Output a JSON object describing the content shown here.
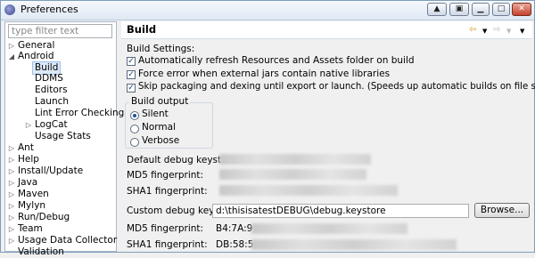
{
  "window": {
    "title": "Preferences"
  },
  "filter": {
    "placeholder": "type filter text"
  },
  "tree": {
    "general": "General",
    "android": "Android",
    "build": "Build",
    "ddms": "DDMS",
    "editors": "Editors",
    "launch": "Launch",
    "lint": "Lint Error Checking",
    "logcat": "LogCat",
    "usage_stats": "Usage Stats",
    "ant": "Ant",
    "help": "Help",
    "install_update": "Install/Update",
    "java": "Java",
    "maven": "Maven",
    "mylyn": "Mylyn",
    "run_debug": "Run/Debug",
    "team": "Team",
    "usage_data_collector": "Usage Data Collector",
    "validation": "Validation"
  },
  "page": {
    "title": "Build",
    "section_label": "Build Settings:"
  },
  "settings": {
    "auto_refresh": {
      "label": "Automatically refresh Resources and Assets folder on build",
      "checked": true
    },
    "force_error": {
      "label": "Force error when external jars contain native libraries",
      "checked": true
    },
    "skip_packaging": {
      "label": "Skip packaging and dexing until export or launch. (Speeds up automatic builds on file save)",
      "checked": true
    }
  },
  "build_output": {
    "title": "Build output",
    "options": {
      "silent": "Silent",
      "normal": "Normal",
      "verbose": "Verbose"
    },
    "selected": "Silent"
  },
  "keystore": {
    "default_label": "Default debug keystore:",
    "md5_label": "MD5 fingerprint:",
    "sha1_label": "SHA1 fingerprint:",
    "custom_label": "Custom debug keystore:",
    "custom_value": "d:\\thisisatestDEBUG\\debug.keystore",
    "browse": "Browse...",
    "custom_md5_label": "MD5 fingerprint:",
    "custom_md5_value": "B4:7A:9",
    "custom_sha1_label": "SHA1 fingerprint:",
    "custom_sha1_value": "DB:58:5"
  },
  "icons": {
    "back": "back-arrow-icon",
    "forward": "forward-arrow-icon",
    "menu": "view-menu-icon"
  }
}
